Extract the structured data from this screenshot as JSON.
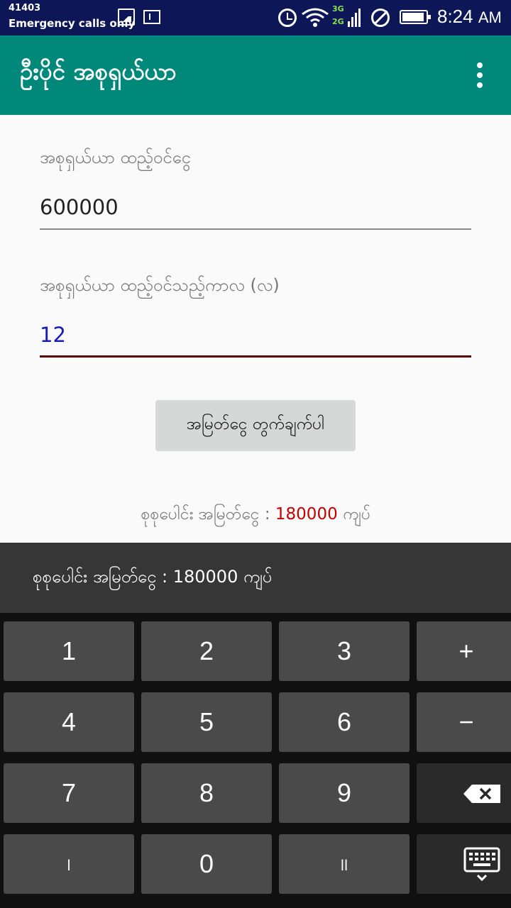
{
  "status_bar": {
    "carrier_code": "41403",
    "carrier_text": "Emergency calls only",
    "network_3g": "3G",
    "network_2g": "2G",
    "time": "8:24",
    "ampm": "AM"
  },
  "app_bar": {
    "title": "ဦးပိုင် အစုရှယ်ယာ"
  },
  "form": {
    "amount_label": "အစုရှယ်ယာ ထည့်ဝင်ငွေ",
    "amount_value": "600000",
    "period_label": "အစုရှယ်ယာ ထည့်ဝင်သည့်ကာလ (လ)",
    "period_value": "12",
    "calc_button_label": "အမြတ်ငွေ တွက်ချက်ပါ"
  },
  "result": {
    "prefix": "စုစုပေါင်း အမြတ်ငွေ : ",
    "value": "180000",
    "suffix": " ကျပ်"
  },
  "toast": {
    "text": "စုစုပေါင်း အမြတ်ငွေ : 180000 ကျပ်"
  },
  "keyboard": {
    "row1": [
      "1",
      "2",
      "3",
      "+"
    ],
    "row2": [
      "4",
      "5",
      "6",
      "−"
    ],
    "row3": [
      "7",
      "8",
      "9"
    ],
    "row4": [
      "၊",
      "0",
      "။"
    ],
    "icons": {
      "backspace": "backspace-icon",
      "keyboard": "keyboard-hide-icon"
    }
  },
  "colors": {
    "status_bar": "#0d1757",
    "app_bar": "#00897b",
    "result_value": "#c80000",
    "period_value": "#1a1ab8"
  }
}
